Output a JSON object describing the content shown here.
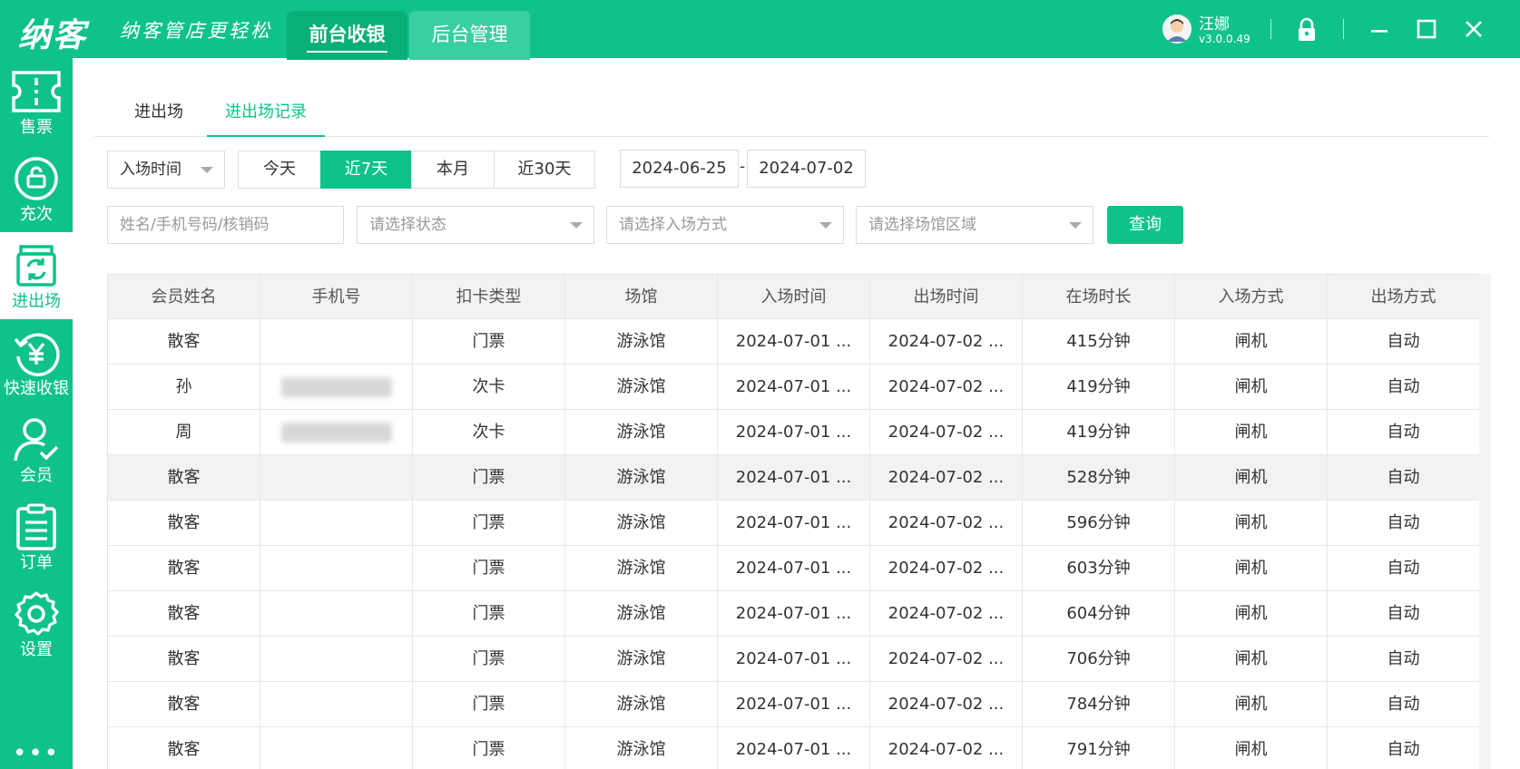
{
  "app": {
    "logo": "纳客",
    "slogan": "纳客管店更轻松",
    "tabs": [
      {
        "label": "前台收银",
        "active": true
      },
      {
        "label": "后台管理",
        "active": false
      }
    ],
    "user": {
      "name": "汪娜",
      "version": "v3.0.0.49"
    },
    "accent_color": "#0fc28a"
  },
  "sidebar": {
    "items": [
      {
        "label": "售票",
        "icon": "ticket-icon"
      },
      {
        "label": "充次",
        "icon": "recharge-icon"
      },
      {
        "label": "进出场",
        "icon": "entry-exit-icon",
        "active": true
      },
      {
        "label": "快速收银",
        "icon": "yen-cashier-icon"
      },
      {
        "label": "会员",
        "icon": "member-icon"
      },
      {
        "label": "订单",
        "icon": "order-icon"
      },
      {
        "label": "设置",
        "icon": "gear-icon"
      }
    ],
    "more": "•••"
  },
  "subtabs": [
    {
      "label": "进出场",
      "active": false
    },
    {
      "label": "进出场记录",
      "active": true
    }
  ],
  "filters": {
    "time_type": "入场时间",
    "ranges": [
      {
        "label": "今天",
        "active": false
      },
      {
        "label": "近7天",
        "active": true
      },
      {
        "label": "本月",
        "active": false
      },
      {
        "label": "近30天",
        "active": false
      }
    ],
    "date_start": "2024-06-25",
    "date_sep": "-",
    "date_end": "2024-07-02",
    "search_placeholder": "姓名/手机号码/核销码",
    "status_placeholder": "请选择状态",
    "entry_method_placeholder": "请选择入场方式",
    "area_placeholder": "请选择场馆区域",
    "query_label": "查询"
  },
  "table": {
    "columns": [
      "会员姓名",
      "手机号",
      "扣卡类型",
      "场馆",
      "入场时间",
      "出场时间",
      "在场时长",
      "入场方式",
      "出场方式"
    ],
    "rows": [
      {
        "name": "散客",
        "phone": "",
        "phone_blurred": false,
        "card_type": "门票",
        "venue": "游泳馆",
        "entry_time": "2024-07-01 ...",
        "exit_time": "2024-07-02 ...",
        "duration": "415分钟",
        "entry_method": "闸机",
        "exit_method": "自动"
      },
      {
        "name": "孙",
        "phone": "",
        "phone_blurred": true,
        "card_type": "次卡",
        "venue": "游泳馆",
        "entry_time": "2024-07-01 ...",
        "exit_time": "2024-07-02 ...",
        "duration": "419分钟",
        "entry_method": "闸机",
        "exit_method": "自动"
      },
      {
        "name": "周",
        "phone": "",
        "phone_blurred": true,
        "card_type": "次卡",
        "venue": "游泳馆",
        "entry_time": "2024-07-01 ...",
        "exit_time": "2024-07-02 ...",
        "duration": "419分钟",
        "entry_method": "闸机",
        "exit_method": "自动"
      },
      {
        "name": "散客",
        "phone": "",
        "phone_blurred": false,
        "card_type": "门票",
        "venue": "游泳馆",
        "entry_time": "2024-07-01 ...",
        "exit_time": "2024-07-02 ...",
        "duration": "528分钟",
        "entry_method": "闸机",
        "exit_method": "自动",
        "highlighted": true
      },
      {
        "name": "散客",
        "phone": "",
        "phone_blurred": false,
        "card_type": "门票",
        "venue": "游泳馆",
        "entry_time": "2024-07-01 ...",
        "exit_time": "2024-07-02 ...",
        "duration": "596分钟",
        "entry_method": "闸机",
        "exit_method": "自动"
      },
      {
        "name": "散客",
        "phone": "",
        "phone_blurred": false,
        "card_type": "门票",
        "venue": "游泳馆",
        "entry_time": "2024-07-01 ...",
        "exit_time": "2024-07-02 ...",
        "duration": "603分钟",
        "entry_method": "闸机",
        "exit_method": "自动"
      },
      {
        "name": "散客",
        "phone": "",
        "phone_blurred": false,
        "card_type": "门票",
        "venue": "游泳馆",
        "entry_time": "2024-07-01 ...",
        "exit_time": "2024-07-02 ...",
        "duration": "604分钟",
        "entry_method": "闸机",
        "exit_method": "自动"
      },
      {
        "name": "散客",
        "phone": "",
        "phone_blurred": false,
        "card_type": "门票",
        "venue": "游泳馆",
        "entry_time": "2024-07-01 ...",
        "exit_time": "2024-07-02 ...",
        "duration": "706分钟",
        "entry_method": "闸机",
        "exit_method": "自动"
      },
      {
        "name": "散客",
        "phone": "",
        "phone_blurred": false,
        "card_type": "门票",
        "venue": "游泳馆",
        "entry_time": "2024-07-01 ...",
        "exit_time": "2024-07-02 ...",
        "duration": "784分钟",
        "entry_method": "闸机",
        "exit_method": "自动"
      },
      {
        "name": "散客",
        "phone": "",
        "phone_blurred": false,
        "card_type": "门票",
        "venue": "游泳馆",
        "entry_time": "2024-07-01 ...",
        "exit_time": "2024-07-02 ...",
        "duration": "791分钟",
        "entry_method": "闸机",
        "exit_method": "自动"
      }
    ]
  }
}
